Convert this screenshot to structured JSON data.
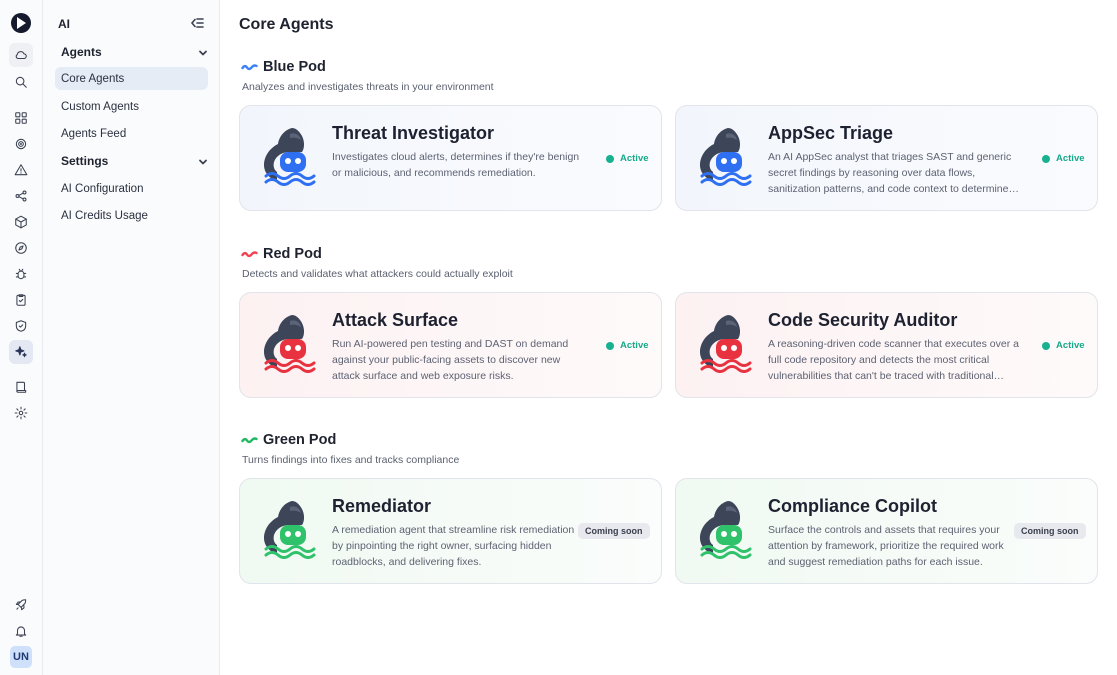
{
  "sidebar": {
    "title": "AI",
    "sections": [
      {
        "label": "Agents",
        "items": [
          "Core Agents",
          "Custom Agents",
          "Agents Feed"
        ]
      },
      {
        "label": "Settings",
        "items": [
          "AI Configuration",
          "AI Credits Usage"
        ]
      }
    ],
    "selected_item": "Core Agents"
  },
  "rail": {
    "icons": [
      "logo",
      "cloud-icon",
      "search-icon",
      "dashboard-icon",
      "target-icon",
      "alert-triangle-icon",
      "nodes-icon",
      "cube-icon",
      "compass-icon",
      "bug-icon",
      "clipboard-check-icon",
      "shield-icon",
      "sparkles-icon",
      "book-icon",
      "gear-icon",
      "rocket-icon",
      "bell-icon"
    ],
    "active_icon": "sparkles-icon",
    "avatar": "UN"
  },
  "page": {
    "title": "Core Agents"
  },
  "colors": {
    "blue": "#3b82f6",
    "red": "#ef4454",
    "green": "#22b863",
    "active_green": "#17a98a"
  },
  "pods": [
    {
      "name": "Blue Pod",
      "description": "Analyzes and investigates threats in your environment",
      "agents": [
        {
          "title": "Threat Investigator",
          "description": "Investigates cloud alerts, determines if they're benign or malicious, and recommends remediation.",
          "status": "Active"
        },
        {
          "title": "AppSec Triage",
          "description": "An AI AppSec analyst that triages SAST and generic secret findings by reasoning over data flows, sanitization patterns, and code context to determine exploitability.",
          "status": "Active"
        }
      ]
    },
    {
      "name": "Red Pod",
      "description": "Detects and validates what attackers could actually exploit",
      "agents": [
        {
          "title": "Attack Surface",
          "description": "Run AI-powered pen testing and DAST on demand against your public-facing assets to discover new attack surface and web exposure risks.",
          "status": "Active"
        },
        {
          "title": "Code Security Auditor",
          "description": "A reasoning-driven code scanner that executes over a full code repository and detects the most critical vulnerabilities that can't be traced with traditional scanners.",
          "status": "Active"
        }
      ]
    },
    {
      "name": "Green Pod",
      "description": "Turns findings into fixes and tracks compliance",
      "agents": [
        {
          "title": "Remediator",
          "description": "A remediation agent that streamline risk remediation by pinpointing the right owner, surfacing hidden roadblocks, and delivering fixes.",
          "status": "Coming soon"
        },
        {
          "title": "Compliance Copilot",
          "description": "Surface the controls and assets that requires your attention by framework, prioritize the required work and suggest remediation paths for each issue.",
          "status": "Coming soon"
        }
      ]
    }
  ]
}
